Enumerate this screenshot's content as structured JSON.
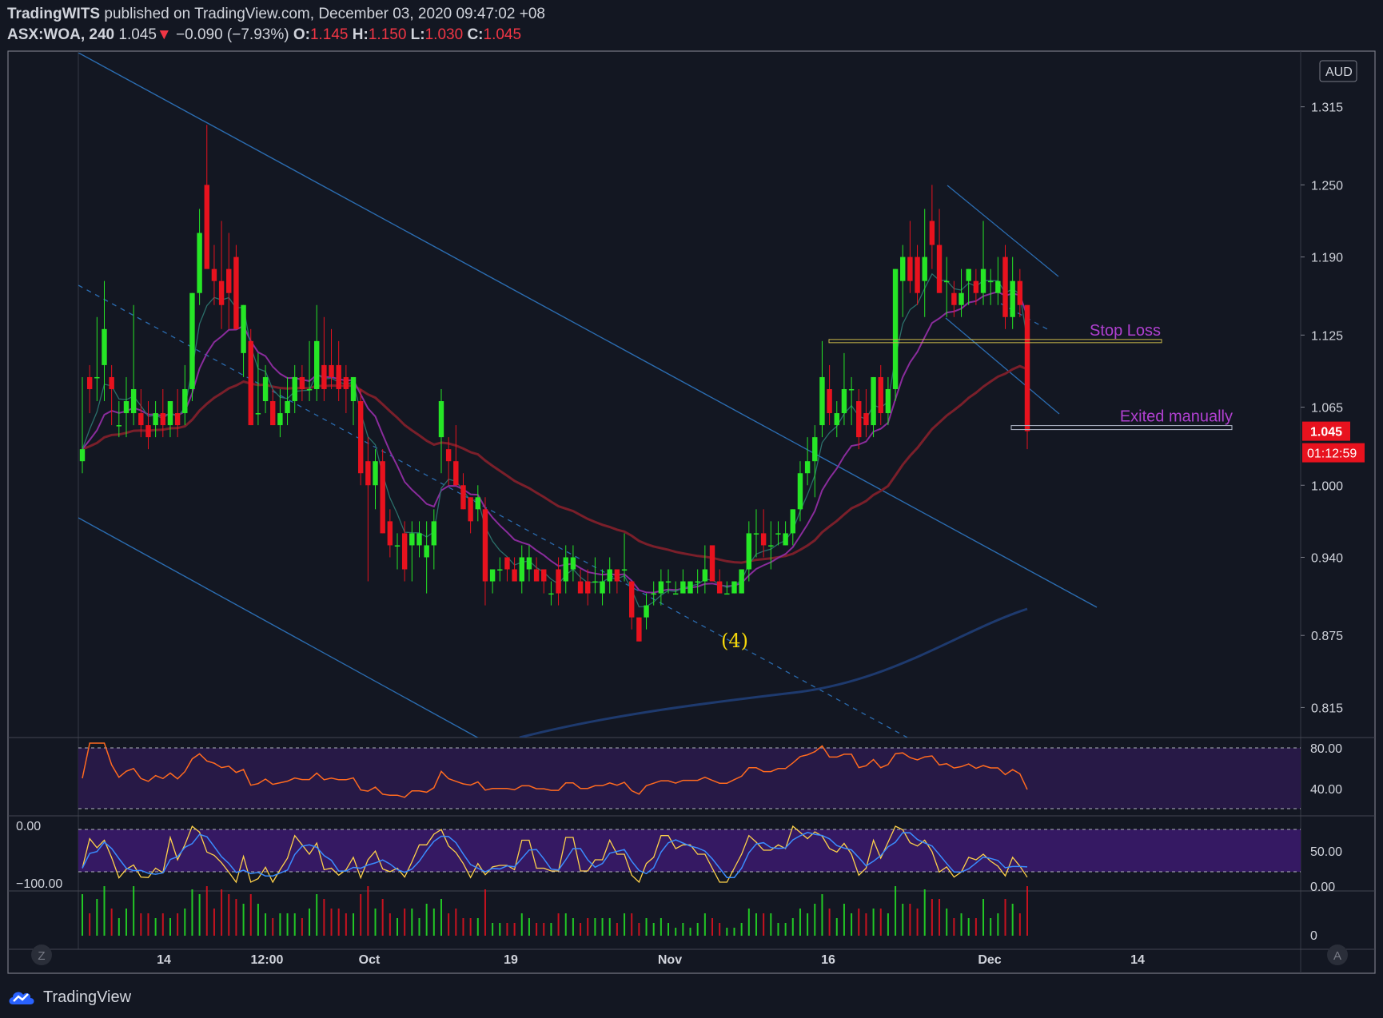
{
  "header": {
    "publisher": "TradingWITS",
    "published_text": "published on TradingView.com, December 03, 2020 09:47:02 +08",
    "symbol": "ASX:WOA, 240",
    "last": "1.045",
    "change": "−0.090 (−7.93%)",
    "o_label": "O:",
    "o_value": "1.145",
    "h_label": "H:",
    "h_value": "1.150",
    "l_label": "L:",
    "l_value": "1.030",
    "c_label": "C:",
    "c_value": "1.045"
  },
  "footer": {
    "brand": "TradingView"
  },
  "chart_data": {
    "type": "candlestick",
    "currency": "AUD",
    "price_axis": {
      "ticks": [
        "1.315",
        "1.250",
        "1.190",
        "1.125",
        "1.065",
        "1.000",
        "0.940",
        "0.875",
        "0.815"
      ],
      "range": [
        0.79,
        1.36
      ]
    },
    "time_axis": {
      "ticks": [
        "14",
        "12:00",
        "Oct",
        "19",
        "Nov",
        "16",
        "Dec",
        "14"
      ]
    },
    "last_price_label": "1.045",
    "countdown_label": "01:12:59",
    "annotations": [
      "Stop Loss",
      "Exited manually",
      "(4)"
    ],
    "stop_loss_level": 1.12,
    "exit_level": 1.045,
    "axis_buttons": {
      "left": "Z",
      "right": "A"
    },
    "candles": [
      [
        1.02,
        1.09,
        1.01,
        1.03
      ],
      [
        1.09,
        1.1,
        1.06,
        1.08
      ],
      [
        1.09,
        1.14,
        1.07,
        1.09
      ],
      [
        1.1,
        1.17,
        1.07,
        1.13
      ],
      [
        1.09,
        1.1,
        1.05,
        1.08
      ],
      [
        1.05,
        1.07,
        1.04,
        1.05
      ],
      [
        1.06,
        1.09,
        1.04,
        1.07
      ],
      [
        1.06,
        1.15,
        1.05,
        1.08
      ],
      [
        1.06,
        1.08,
        1.04,
        1.05
      ],
      [
        1.05,
        1.07,
        1.03,
        1.04
      ],
      [
        1.05,
        1.07,
        1.04,
        1.06
      ],
      [
        1.06,
        1.08,
        1.04,
        1.05
      ],
      [
        1.05,
        1.07,
        1.04,
        1.07
      ],
      [
        1.06,
        1.08,
        1.04,
        1.05
      ],
      [
        1.06,
        1.1,
        1.05,
        1.08
      ],
      [
        1.08,
        1.16,
        1.07,
        1.16
      ],
      [
        1.16,
        1.23,
        1.15,
        1.21
      ],
      [
        1.25,
        1.3,
        1.2,
        1.18
      ],
      [
        1.18,
        1.2,
        1.15,
        1.17
      ],
      [
        1.17,
        1.22,
        1.13,
        1.15
      ],
      [
        1.18,
        1.21,
        1.13,
        1.16
      ],
      [
        1.19,
        1.2,
        1.13,
        1.13
      ],
      [
        1.11,
        1.15,
        1.09,
        1.15
      ],
      [
        1.12,
        1.13,
        1.05,
        1.05
      ],
      [
        1.06,
        1.11,
        1.05,
        1.06
      ],
      [
        1.07,
        1.1,
        1.06,
        1.09
      ],
      [
        1.07,
        1.08,
        1.05,
        1.05
      ],
      [
        1.05,
        1.08,
        1.04,
        1.06
      ],
      [
        1.06,
        1.09,
        1.05,
        1.07
      ],
      [
        1.07,
        1.1,
        1.06,
        1.09
      ],
      [
        1.09,
        1.1,
        1.07,
        1.08
      ],
      [
        1.08,
        1.12,
        1.07,
        1.08
      ],
      [
        1.08,
        1.15,
        1.07,
        1.12
      ],
      [
        1.1,
        1.14,
        1.07,
        1.08
      ],
      [
        1.1,
        1.13,
        1.08,
        1.09
      ],
      [
        1.1,
        1.12,
        1.07,
        1.08
      ],
      [
        1.09,
        1.1,
        1.06,
        1.08
      ],
      [
        1.07,
        1.09,
        1.05,
        1.09
      ],
      [
        1.07,
        1.08,
        1.0,
        1.01
      ],
      [
        1.02,
        1.04,
        0.92,
        1.0
      ],
      [
        1.0,
        1.03,
        0.98,
        1.02
      ],
      [
        1.02,
        1.03,
        0.96,
        0.96
      ],
      [
        0.97,
        0.98,
        0.94,
        0.95
      ],
      [
        0.95,
        0.96,
        0.93,
        0.95
      ],
      [
        0.96,
        0.97,
        0.92,
        0.93
      ],
      [
        0.95,
        0.97,
        0.92,
        0.96
      ],
      [
        0.95,
        0.97,
        0.94,
        0.96
      ],
      [
        0.94,
        0.97,
        0.91,
        0.95
      ],
      [
        0.95,
        0.98,
        0.93,
        0.97
      ],
      [
        1.04,
        1.08,
        1.01,
        1.07
      ],
      [
        1.03,
        1.04,
        1.0,
        1.02
      ],
      [
        1.02,
        1.05,
        1.0,
        1.0
      ],
      [
        1.0,
        1.01,
        0.98,
        0.98
      ],
      [
        0.99,
        0.99,
        0.96,
        0.97
      ],
      [
        0.98,
        1.0,
        0.97,
        0.99
      ],
      [
        0.98,
        0.99,
        0.9,
        0.92
      ],
      [
        0.92,
        0.93,
        0.91,
        0.93
      ],
      [
        0.93,
        0.94,
        0.92,
        0.93
      ],
      [
        0.94,
        0.94,
        0.92,
        0.93
      ],
      [
        0.93,
        0.94,
        0.92,
        0.92
      ],
      [
        0.92,
        0.95,
        0.91,
        0.94
      ],
      [
        0.93,
        0.95,
        0.92,
        0.94
      ],
      [
        0.93,
        0.94,
        0.92,
        0.92
      ],
      [
        0.93,
        0.93,
        0.91,
        0.92
      ],
      [
        0.91,
        0.92,
        0.9,
        0.91
      ],
      [
        0.93,
        0.94,
        0.9,
        0.91
      ],
      [
        0.92,
        0.95,
        0.91,
        0.94
      ],
      [
        0.93,
        0.95,
        0.92,
        0.94
      ],
      [
        0.92,
        0.93,
        0.91,
        0.91
      ],
      [
        0.92,
        0.93,
        0.9,
        0.91
      ],
      [
        0.92,
        0.94,
        0.91,
        0.92
      ],
      [
        0.91,
        0.93,
        0.9,
        0.92
      ],
      [
        0.92,
        0.94,
        0.91,
        0.93
      ],
      [
        0.93,
        0.93,
        0.91,
        0.92
      ],
      [
        0.93,
        0.96,
        0.92,
        0.93
      ],
      [
        0.92,
        0.92,
        0.88,
        0.89
      ],
      [
        0.89,
        0.89,
        0.87,
        0.87
      ],
      [
        0.89,
        0.91,
        0.88,
        0.9
      ],
      [
        0.91,
        0.92,
        0.9,
        0.91
      ],
      [
        0.91,
        0.93,
        0.9,
        0.92
      ],
      [
        0.92,
        0.93,
        0.91,
        0.92
      ],
      [
        0.91,
        0.92,
        0.91,
        0.91
      ],
      [
        0.91,
        0.93,
        0.91,
        0.92
      ],
      [
        0.91,
        0.92,
        0.91,
        0.92
      ],
      [
        0.92,
        0.93,
        0.91,
        0.92
      ],
      [
        0.92,
        0.95,
        0.91,
        0.93
      ],
      [
        0.95,
        0.95,
        0.92,
        0.92
      ],
      [
        0.92,
        0.93,
        0.91,
        0.91
      ],
      [
        0.91,
        0.92,
        0.91,
        0.91
      ],
      [
        0.91,
        0.92,
        0.91,
        0.92
      ],
      [
        0.91,
        0.93,
        0.91,
        0.93
      ],
      [
        0.93,
        0.97,
        0.92,
        0.96
      ],
      [
        0.96,
        0.98,
        0.94,
        0.96
      ],
      [
        0.96,
        0.98,
        0.94,
        0.95
      ],
      [
        0.95,
        0.97,
        0.93,
        0.95
      ],
      [
        0.96,
        0.97,
        0.95,
        0.96
      ],
      [
        0.95,
        0.97,
        0.95,
        0.96
      ],
      [
        0.96,
        0.98,
        0.95,
        0.98
      ],
      [
        0.98,
        1.02,
        0.97,
        1.01
      ],
      [
        1.01,
        1.04,
        1.0,
        1.02
      ],
      [
        1.02,
        1.05,
        0.99,
        1.04
      ],
      [
        1.05,
        1.12,
        1.04,
        1.09
      ],
      [
        1.08,
        1.1,
        1.05,
        1.06
      ],
      [
        1.05,
        1.07,
        1.04,
        1.06
      ],
      [
        1.06,
        1.11,
        1.05,
        1.08
      ],
      [
        1.08,
        1.09,
        1.05,
        1.08
      ],
      [
        1.07,
        1.08,
        1.03,
        1.04
      ],
      [
        1.06,
        1.08,
        1.04,
        1.05
      ],
      [
        1.05,
        1.09,
        1.04,
        1.09
      ],
      [
        1.09,
        1.1,
        1.05,
        1.06
      ],
      [
        1.06,
        1.09,
        1.05,
        1.08
      ],
      [
        1.08,
        1.18,
        1.07,
        1.18
      ],
      [
        1.17,
        1.2,
        1.14,
        1.19
      ],
      [
        1.19,
        1.22,
        1.16,
        1.17
      ],
      [
        1.19,
        1.2,
        1.15,
        1.16
      ],
      [
        1.17,
        1.23,
        1.14,
        1.19
      ],
      [
        1.22,
        1.25,
        1.18,
        1.2
      ],
      [
        1.2,
        1.23,
        1.16,
        1.16
      ],
      [
        1.17,
        1.19,
        1.14,
        1.17
      ],
      [
        1.16,
        1.17,
        1.14,
        1.15
      ],
      [
        1.15,
        1.18,
        1.14,
        1.16
      ],
      [
        1.17,
        1.18,
        1.15,
        1.18
      ],
      [
        1.17,
        1.18,
        1.15,
        1.16
      ],
      [
        1.16,
        1.22,
        1.15,
        1.18
      ],
      [
        1.17,
        1.18,
        1.15,
        1.17
      ],
      [
        1.16,
        1.19,
        1.15,
        1.17
      ],
      [
        1.19,
        1.2,
        1.13,
        1.14
      ],
      [
        1.14,
        1.19,
        1.13,
        1.17
      ],
      [
        1.17,
        1.18,
        1.14,
        1.15
      ],
      [
        1.15,
        1.15,
        1.03,
        1.045
      ]
    ],
    "rsi": {
      "levels": [
        "80.00",
        "40.00"
      ]
    },
    "stoch": {
      "left_ticks": [
        "0.00",
        "−100.00"
      ],
      "right_ticks": [
        "50.00",
        "0.00"
      ]
    },
    "volume": {
      "ticks": [
        "0"
      ]
    },
    "colors": {
      "up": "#26e626",
      "down": "#e8121e",
      "background": "#131722",
      "channel": "#2b6cb0"
    }
  }
}
